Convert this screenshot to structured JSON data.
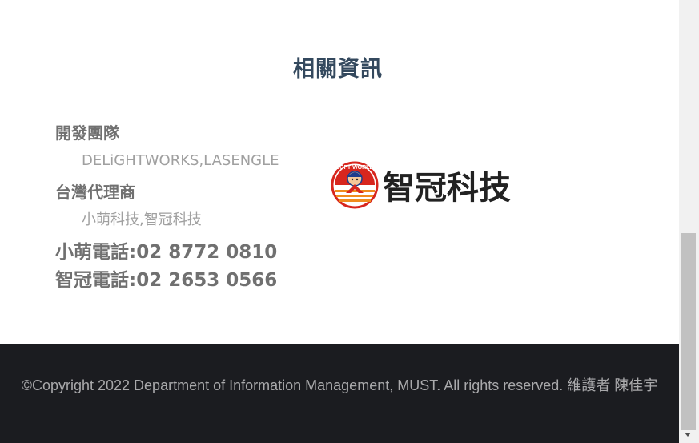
{
  "section": {
    "title": "相關資訊"
  },
  "info": {
    "developer_heading": "開發團隊",
    "developer_value": "DELiGHTWORKS,LASENGLE",
    "distributor_heading": "台灣代理商",
    "distributor_value": "小萌科技,智冠科技",
    "phone_1": "小萌電話:02 8772 0810",
    "phone_2": "智冠電話:02 2653 0566"
  },
  "logo": {
    "badge_text": "SOFT WORLD",
    "name": "智冠科技",
    "colors": {
      "red": "#d7261e",
      "orange": "#f08c1e",
      "blue": "#1e3c8c",
      "dark": "#222222"
    }
  },
  "footer": {
    "text": "©Copyright 2022 Department of Information Management, MUST. All rights reserved. 維護者 陳佳宇"
  },
  "colors": {
    "title": "#34495e",
    "footer_bg": "#1b1c20",
    "footer_text": "#a9a9ab"
  }
}
